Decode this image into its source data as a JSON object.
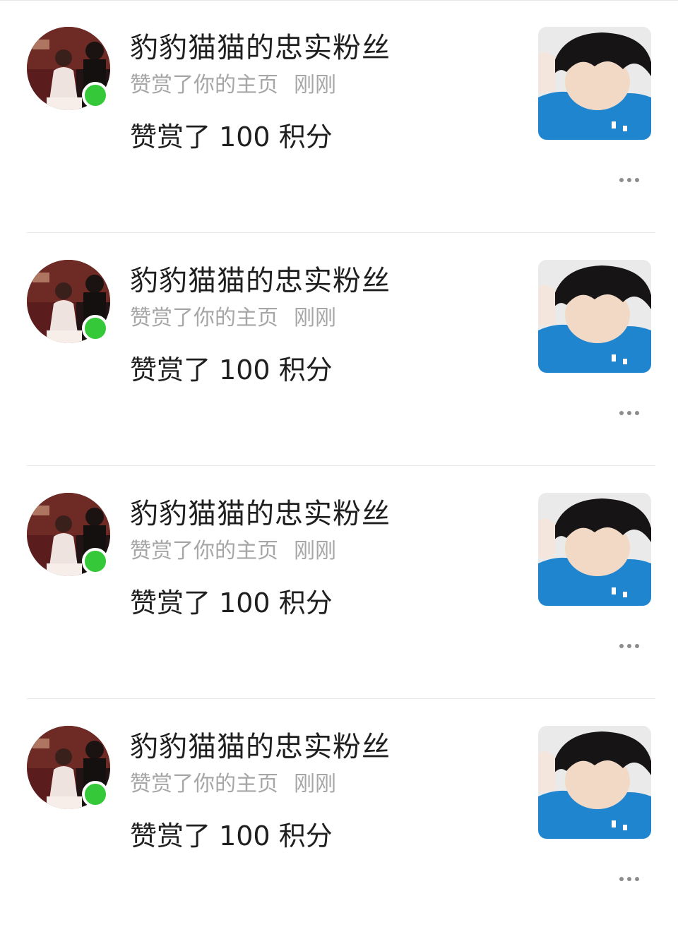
{
  "notifications": [
    {
      "name": "豹豹猫猫的忠实粉丝",
      "action": "赞赏了你的主页",
      "time": "刚刚",
      "content": "赞赏了 100 积分"
    },
    {
      "name": "豹豹猫猫的忠实粉丝",
      "action": "赞赏了你的主页",
      "time": "刚刚",
      "content": "赞赏了 100 积分"
    },
    {
      "name": "豹豹猫猫的忠实粉丝",
      "action": "赞赏了你的主页",
      "time": "刚刚",
      "content": "赞赏了 100 积分"
    },
    {
      "name": "豹豹猫猫的忠实粉丝",
      "action": "赞赏了你的主页",
      "time": "刚刚",
      "content": "赞赏了 100 积分"
    }
  ],
  "icons": {
    "more": "more-horizontal-icon",
    "online": "online-status-dot"
  },
  "colors": {
    "online": "#35c93a",
    "primary_text": "#1f1f1f",
    "secondary_text": "#a6a6a6",
    "divider": "#e8e8e8",
    "more_dots": "#8c8c8c"
  }
}
